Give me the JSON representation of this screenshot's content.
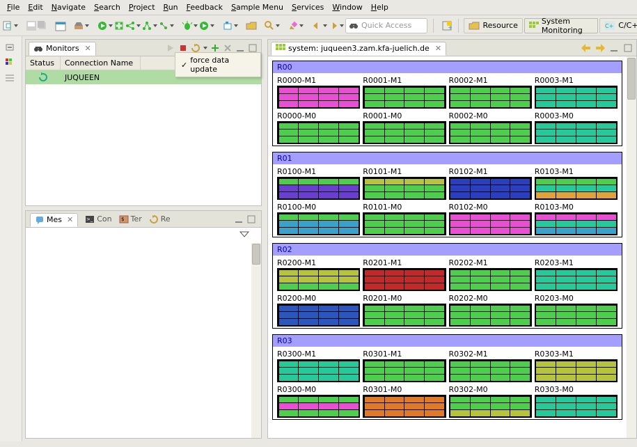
{
  "menu": [
    "File",
    "Edit",
    "Navigate",
    "Search",
    "Project",
    "Run",
    "Feedback",
    "Sample Menu",
    "Services",
    "Window",
    "Help"
  ],
  "quick_access_placeholder": "Quick Access",
  "perspectives": [
    {
      "label": "Resource",
      "icon": "folder"
    },
    {
      "label": "System Monitoring",
      "icon": "monitor",
      "active": true
    },
    {
      "label": "C/C++",
      "icon": "cpp"
    }
  ],
  "monitors_view": {
    "title": "Monitors",
    "columns": [
      "Status",
      "Connection Name"
    ],
    "row": {
      "status_icon": "refresh",
      "name": "JUQUEEN",
      "rest": ""
    },
    "tooltip": "force data update"
  },
  "tabs": [
    {
      "label": "Mes",
      "icon": "bubble",
      "active": true
    },
    {
      "label": "Con",
      "icon": "console"
    },
    {
      "label": "Ter",
      "icon": "terminal"
    },
    {
      "label": "Re",
      "icon": "refresh"
    }
  ],
  "system_view": {
    "title": "system: juqueen3.zam.kfa-juelich.de"
  },
  "racks": [
    {
      "name": "R00",
      "nodes": [
        {
          "label": "R0000-M1",
          "rows": [
            [
              "#e84fd2",
              "#e84fd2",
              "#e84fd2",
              "#e84fd2"
            ],
            [
              "#e84fd2",
              "#e84fd2",
              "#e84fd2",
              "#e84fd2"
            ],
            [
              "#e84fd2",
              "#e84fd2",
              "#e84fd2",
              "#e84fd2"
            ]
          ]
        },
        {
          "label": "R0001-M1",
          "rows": [
            [
              "#4dcf4d",
              "#4dcf4d",
              "#4dcf4d",
              "#4dcf4d"
            ],
            [
              "#4dcf4d",
              "#4dcf4d",
              "#4dcf4d",
              "#4dcf4d"
            ],
            [
              "#4dcf4d",
              "#4dcf4d",
              "#4dcf4d",
              "#4dcf4d"
            ]
          ]
        },
        {
          "label": "R0002-M1",
          "rows": [
            [
              "#4dcf4d",
              "#4dcf4d",
              "#4dcf4d",
              "#4dcf4d"
            ],
            [
              "#4dcf4d",
              "#4dcf4d",
              "#4dcf4d",
              "#4dcf4d"
            ],
            [
              "#4dcf4d",
              "#4dcf4d",
              "#4dcf4d",
              "#4dcf4d"
            ]
          ]
        },
        {
          "label": "R0003-M1",
          "rows": [
            [
              "#25c99c",
              "#25c99c",
              "#25c99c",
              "#25c99c"
            ],
            [
              "#25c99c",
              "#25c99c",
              "#25c99c",
              "#25c99c"
            ],
            [
              "#25c99c",
              "#25c99c",
              "#25c99c",
              "#25c99c"
            ]
          ]
        },
        {
          "label": "R0000-M0",
          "rows": [
            [
              "#4dcf4d",
              "#4dcf4d",
              "#4dcf4d",
              "#4dcf4d"
            ],
            [
              "#4dcf4d",
              "#4dcf4d",
              "#4dcf4d",
              "#4dcf4d"
            ],
            [
              "#4dcf4d",
              "#4dcf4d",
              "#4dcf4d",
              "#4dcf4d"
            ]
          ]
        },
        {
          "label": "R0001-M0",
          "rows": [
            [
              "#4dcf4d",
              "#4dcf4d",
              "#4dcf4d",
              "#4dcf4d"
            ],
            [
              "#4dcf4d",
              "#4dcf4d",
              "#4dcf4d",
              "#4dcf4d"
            ],
            [
              "#4dcf4d",
              "#4dcf4d",
              "#4dcf4d",
              "#4dcf4d"
            ]
          ]
        },
        {
          "label": "R0002-M0",
          "rows": [
            [
              "#4dcf4d",
              "#4dcf4d",
              "#4dcf4d",
              "#4dcf4d"
            ],
            [
              "#4dcf4d",
              "#4dcf4d",
              "#4dcf4d",
              "#4dcf4d"
            ],
            [
              "#4dcf4d",
              "#4dcf4d",
              "#4dcf4d",
              "#4dcf4d"
            ]
          ]
        },
        {
          "label": "R0003-M0",
          "rows": [
            [
              "#25c99c",
              "#25c99c",
              "#25c99c",
              "#25c99c"
            ],
            [
              "#25c99c",
              "#25c99c",
              "#25c99c",
              "#25c99c"
            ],
            [
              "#25c99c",
              "#25c99c",
              "#25c99c",
              "#25c99c"
            ]
          ]
        }
      ]
    },
    {
      "name": "R01",
      "nodes": [
        {
          "label": "R0100-M1",
          "rows": [
            [
              "#4dcf4d",
              "#4dcf4d",
              "#4dcf4d",
              "#4dcf4d"
            ],
            [
              "#6a3fd0",
              "#6a3fd0",
              "#6a3fd0",
              "#6a3fd0"
            ],
            [
              "#6a3fd0",
              "#6a3fd0",
              "#6a3fd0",
              "#6a3fd0"
            ]
          ]
        },
        {
          "label": "R0101-M1",
          "rows": [
            [
              "#b8c33d",
              "#b8c33d",
              "#b8c33d",
              "#b8c33d"
            ],
            [
              "#4dcf4d",
              "#4dcf4d",
              "#4dcf4d",
              "#4dcf4d"
            ],
            [
              "#4dcf4d",
              "#4dcf4d",
              "#4dcf4d",
              "#4dcf4d"
            ]
          ]
        },
        {
          "label": "R0102-M1",
          "rows": [
            [
              "#2a3fc0",
              "#2a3fc0",
              "#2a3fc0",
              "#2a3fc0"
            ],
            [
              "#2a3fc0",
              "#2a3fc0",
              "#2a3fc0",
              "#2a3fc0"
            ],
            [
              "#2a3fc0",
              "#2a3fc0",
              "#2a3fc0",
              "#2a3fc0"
            ]
          ]
        },
        {
          "label": "R0103-M1",
          "rows": [
            [
              "#4dcf4d",
              "#4dcf4d",
              "#4dcf4d",
              "#4dcf4d"
            ],
            [
              "#25c99c",
              "#25c99c",
              "#25c99c",
              "#25c99c"
            ],
            [
              "#e0a23d",
              "#e0a23d",
              "#e0a23d",
              "#e0a23d"
            ]
          ]
        },
        {
          "label": "R0100-M0",
          "rows": [
            [
              "#4dcf4d",
              "#4dcf4d",
              "#4dcf4d",
              "#4dcf4d"
            ],
            [
              "#3aa1c9",
              "#3aa1c9",
              "#3aa1c9",
              "#3aa1c9"
            ],
            [
              "#3aa1c9",
              "#3aa1c9",
              "#3aa1c9",
              "#3aa1c9"
            ]
          ]
        },
        {
          "label": "R0101-M0",
          "rows": [
            [
              "#4dcf4d",
              "#4dcf4d",
              "#4dcf4d",
              "#4dcf4d"
            ],
            [
              "#4dcf4d",
              "#4dcf4d",
              "#4dcf4d",
              "#4dcf4d"
            ],
            [
              "#4dcf4d",
              "#4dcf4d",
              "#4dcf4d",
              "#4dcf4d"
            ]
          ]
        },
        {
          "label": "R0102-M0",
          "rows": [
            [
              "#e84fd2",
              "#e84fd2",
              "#e84fd2",
              "#e84fd2"
            ],
            [
              "#e84fd2",
              "#e84fd2",
              "#e84fd2",
              "#e84fd2"
            ],
            [
              "#e84fd2",
              "#e84fd2",
              "#e84fd2",
              "#e84fd2"
            ]
          ]
        },
        {
          "label": "R0103-M0",
          "rows": [
            [
              "#e84fd2",
              "#e84fd2",
              "#e84fd2",
              "#e84fd2"
            ],
            [
              "#25c99c",
              "#25c99c",
              "#25c99c",
              "#25c99c"
            ],
            [
              "#3aa1c9",
              "#3aa1c9",
              "#3aa1c9",
              "#3aa1c9"
            ]
          ]
        }
      ]
    },
    {
      "name": "R02",
      "nodes": [
        {
          "label": "R0200-M1",
          "rows": [
            [
              "#b8c33d",
              "#b8c33d",
              "#b8c33d",
              "#b8c33d"
            ],
            [
              "#b8c33d",
              "#b8c33d",
              "#b8c33d",
              "#b8c33d"
            ],
            [
              "#4dcf4d",
              "#4dcf4d",
              "#4dcf4d",
              "#4dcf4d"
            ]
          ]
        },
        {
          "label": "R0201-M1",
          "rows": [
            [
              "#c22a2a",
              "#c22a2a",
              "#c22a2a",
              "#c22a2a"
            ],
            [
              "#c22a2a",
              "#c22a2a",
              "#c22a2a",
              "#c22a2a"
            ],
            [
              "#c22a2a",
              "#c22a2a",
              "#c22a2a",
              "#c22a2a"
            ]
          ]
        },
        {
          "label": "R0202-M1",
          "rows": [
            [
              "#4dcf4d",
              "#4dcf4d",
              "#4dcf4d",
              "#4dcf4d"
            ],
            [
              "#4dcf4d",
              "#4dcf4d",
              "#4dcf4d",
              "#4dcf4d"
            ],
            [
              "#4dcf4d",
              "#4dcf4d",
              "#4dcf4d",
              "#4dcf4d"
            ]
          ]
        },
        {
          "label": "R0203-M1",
          "rows": [
            [
              "#25c99c",
              "#25c99c",
              "#25c99c",
              "#25c99c"
            ],
            [
              "#25c99c",
              "#25c99c",
              "#25c99c",
              "#25c99c"
            ],
            [
              "#25c99c",
              "#25c99c",
              "#25c99c",
              "#25c99c"
            ]
          ]
        },
        {
          "label": "R0200-M0",
          "rows": [
            [
              "#2a56c0",
              "#2a56c0",
              "#2a56c0",
              "#2a56c0"
            ],
            [
              "#2a56c0",
              "#2a56c0",
              "#2a56c0",
              "#2a56c0"
            ],
            [
              "#2a56c0",
              "#2a56c0",
              "#2a56c0",
              "#2a56c0"
            ]
          ]
        },
        {
          "label": "R0201-M0",
          "rows": [
            [
              "#4dcf4d",
              "#4dcf4d",
              "#4dcf4d",
              "#4dcf4d"
            ],
            [
              "#4dcf4d",
              "#4dcf4d",
              "#4dcf4d",
              "#4dcf4d"
            ],
            [
              "#4dcf4d",
              "#4dcf4d",
              "#4dcf4d",
              "#4dcf4d"
            ]
          ]
        },
        {
          "label": "R0202-M0",
          "rows": [
            [
              "#4dcf4d",
              "#4dcf4d",
              "#4dcf4d",
              "#4dcf4d"
            ],
            [
              "#4dcf4d",
              "#4dcf4d",
              "#4dcf4d",
              "#4dcf4d"
            ],
            [
              "#4dcf4d",
              "#4dcf4d",
              "#4dcf4d",
              "#4dcf4d"
            ]
          ]
        },
        {
          "label": "R0203-M0",
          "rows": [
            [
              "#4dcf4d",
              "#4dcf4d",
              "#4dcf4d",
              "#4dcf4d"
            ],
            [
              "#4dcf4d",
              "#4dcf4d",
              "#4dcf4d",
              "#4dcf4d"
            ],
            [
              "#4dcf4d",
              "#4dcf4d",
              "#4dcf4d",
              "#4dcf4d"
            ]
          ]
        }
      ]
    },
    {
      "name": "R03",
      "nodes": [
        {
          "label": "R0300-M1",
          "rows": [
            [
              "#25c99c",
              "#25c99c",
              "#25c99c",
              "#25c99c"
            ],
            [
              "#25c99c",
              "#25c99c",
              "#25c99c",
              "#25c99c"
            ],
            [
              "#25c99c",
              "#25c99c",
              "#25c99c",
              "#25c99c"
            ]
          ]
        },
        {
          "label": "R0301-M1",
          "rows": [
            [
              "#4dcf4d",
              "#4dcf4d",
              "#4dcf4d",
              "#4dcf4d"
            ],
            [
              "#4dcf4d",
              "#4dcf4d",
              "#4dcf4d",
              "#4dcf4d"
            ],
            [
              "#4dcf4d",
              "#4dcf4d",
              "#4dcf4d",
              "#4dcf4d"
            ]
          ]
        },
        {
          "label": "R0302-M1",
          "rows": [
            [
              "#4dcf4d",
              "#4dcf4d",
              "#4dcf4d",
              "#4dcf4d"
            ],
            [
              "#4dcf4d",
              "#4dcf4d",
              "#4dcf4d",
              "#4dcf4d"
            ],
            [
              "#4dcf4d",
              "#4dcf4d",
              "#4dcf4d",
              "#4dcf4d"
            ]
          ]
        },
        {
          "label": "R0303-M1",
          "rows": [
            [
              "#b8c33d",
              "#b8c33d",
              "#b8c33d",
              "#b8c33d"
            ],
            [
              "#b8c33d",
              "#b8c33d",
              "#b8c33d",
              "#b8c33d"
            ],
            [
              "#b8c33d",
              "#b8c33d",
              "#b8c33d",
              "#b8c33d"
            ]
          ]
        },
        {
          "label": "R0300-M0",
          "rows": [
            [
              "#4dcf4d",
              "#4dcf4d",
              "#4dcf4d",
              "#4dcf4d"
            ],
            [
              "#e84fd2",
              "#e84fd2",
              "#e84fd2",
              "#e84fd2"
            ],
            [
              "#4dcf4d",
              "#4dcf4d",
              "#4dcf4d",
              "#4dcf4d"
            ]
          ]
        },
        {
          "label": "R0301-M0",
          "rows": [
            [
              "#e07a2a",
              "#e07a2a",
              "#e07a2a",
              "#e07a2a"
            ],
            [
              "#e07a2a",
              "#e07a2a",
              "#e07a2a",
              "#e07a2a"
            ],
            [
              "#e07a2a",
              "#e07a2a",
              "#e07a2a",
              "#e07a2a"
            ]
          ]
        },
        {
          "label": "R0302-M0",
          "rows": [
            [
              "#4dcf4d",
              "#4dcf4d",
              "#4dcf4d",
              "#4dcf4d"
            ],
            [
              "#4dcf4d",
              "#4dcf4d",
              "#4dcf4d",
              "#4dcf4d"
            ],
            [
              "#b8c33d",
              "#b8c33d",
              "#b8c33d",
              "#b8c33d"
            ]
          ]
        },
        {
          "label": "R0303-M0",
          "rows": [
            [
              "#25c99c",
              "#25c99c",
              "#25c99c",
              "#25c99c"
            ],
            [
              "#25c99c",
              "#25c99c",
              "#25c99c",
              "#25c99c"
            ],
            [
              "#25c99c",
              "#25c99c",
              "#25c99c",
              "#25c99c"
            ]
          ]
        }
      ]
    }
  ]
}
